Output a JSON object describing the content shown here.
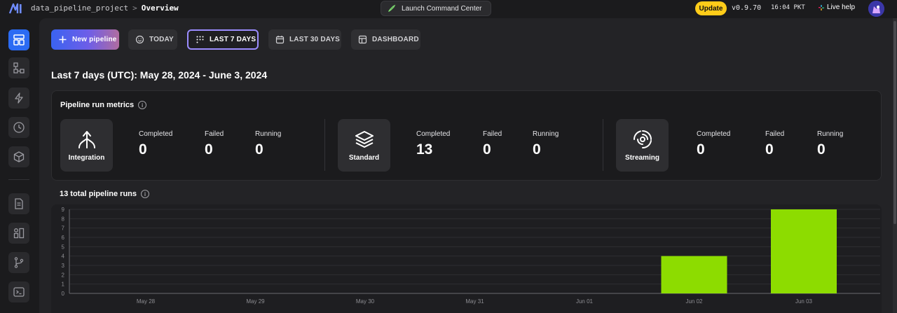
{
  "header": {
    "project": "data_pipeline_project",
    "separator": ">",
    "page": "Overview",
    "launch_label": "Launch Command Center",
    "update_label": "Update",
    "version": "v0.9.70",
    "time": "16:04 PKT",
    "live_help": "Live help"
  },
  "tabs": [
    {
      "label": "New pipeline",
      "icon": "plus-icon"
    },
    {
      "label": "TODAY",
      "icon": "smile-icon"
    },
    {
      "label": "LAST 7 DAYS",
      "icon": "grid-dots-icon"
    },
    {
      "label": "LAST 30 DAYS",
      "icon": "calendar-icon"
    },
    {
      "label": "DASHBOARD",
      "icon": "dashboard-icon"
    }
  ],
  "heading": "Last 7 days (UTC): May 28, 2024 - June 3, 2024",
  "metrics": {
    "title": "Pipeline run metrics",
    "groups": [
      {
        "name": "Integration",
        "icon": "integration-icon",
        "completed": "0",
        "failed": "0",
        "running": "0"
      },
      {
        "name": "Standard",
        "icon": "layers-icon",
        "completed": "13",
        "failed": "0",
        "running": "0"
      },
      {
        "name": "Streaming",
        "icon": "streaming-icon",
        "completed": "0",
        "failed": "0",
        "running": "0"
      }
    ],
    "labels": {
      "completed": "Completed",
      "failed": "Failed",
      "running": "Running"
    }
  },
  "runs_title": "13 total pipeline runs",
  "chart_data": {
    "type": "bar",
    "categories": [
      "May 28",
      "May 29",
      "May 30",
      "May 31",
      "Jun 01",
      "Jun 02",
      "Jun 03"
    ],
    "values": [
      0,
      0,
      0,
      0,
      0,
      4,
      9
    ],
    "ylim": [
      0,
      9
    ],
    "yticks": [
      0,
      1,
      2,
      3,
      4,
      5,
      6,
      7,
      8,
      9
    ],
    "bar_color": "#8ddc00",
    "grid": true
  },
  "colors": {
    "accent": "#2b6bf3",
    "update": "#ffcc19",
    "selected_border": "#9b8cff"
  }
}
